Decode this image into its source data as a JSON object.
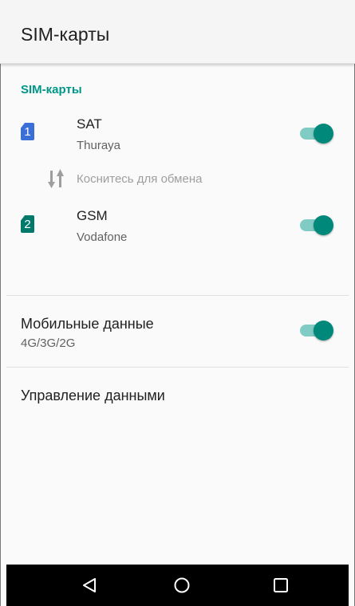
{
  "app_bar": {
    "title": "SIM-карты"
  },
  "section": {
    "header": "SIM-карты"
  },
  "sims": [
    {
      "slot": "1",
      "name": "SAT",
      "operator": "Thuraya",
      "enabled": true,
      "color": "#3b6fd8"
    },
    {
      "slot": "2",
      "name": "GSM",
      "operator": "Vodafone",
      "enabled": true,
      "color": "#00796b"
    }
  ],
  "swap": {
    "label": "Коснитесь для обмена",
    "icon": "swap-arrows-icon"
  },
  "mobile_data": {
    "title": "Мобильные данные",
    "subtitle": "4G/3G/2G",
    "enabled": true
  },
  "data_management": {
    "title": "Управление данными"
  },
  "nav": {
    "back_icon": "back-triangle-icon",
    "home_icon": "home-circle-icon",
    "recents_icon": "recents-square-icon"
  },
  "colors": {
    "accent": "#009688",
    "toggle_thumb": "#00897b",
    "toggle_track": "#80cbc4"
  }
}
